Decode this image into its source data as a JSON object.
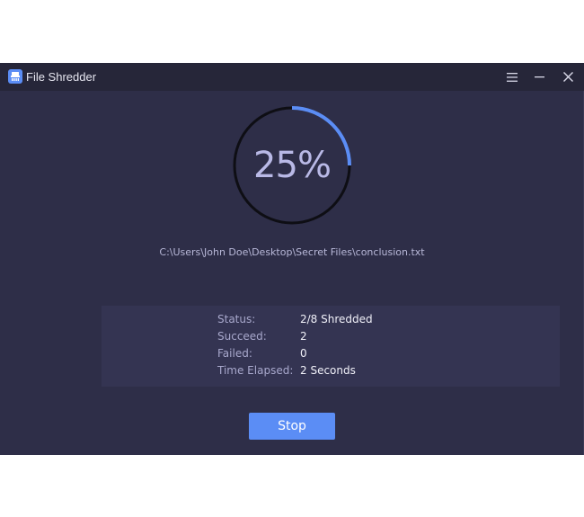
{
  "app": {
    "title": "File Shredder",
    "icon": "shredder-app-icon"
  },
  "titlebar": {
    "menu_icon": "hamburger-menu-icon",
    "minimize_icon": "minimize-icon",
    "close_icon": "close-icon"
  },
  "progress": {
    "percent_label": "25%",
    "value": 0.25,
    "track_color": "#0e0e14",
    "fill_color": "#5b8df5"
  },
  "current_file": "C:\\Users\\John Doe\\Desktop\\Secret Files\\conclusion.txt",
  "stats": [
    {
      "label": "Status:",
      "value": "2/8 Shredded"
    },
    {
      "label": "Succeed:",
      "value": "2"
    },
    {
      "label": "Failed:",
      "value": "0"
    },
    {
      "label": "Time Elapsed:",
      "value": "2 Seconds"
    }
  ],
  "actions": {
    "stop_label": "Stop"
  },
  "colors": {
    "accent": "#5b8df5",
    "window_bg": "#2e2e48",
    "titlebar_bg": "#262639"
  }
}
